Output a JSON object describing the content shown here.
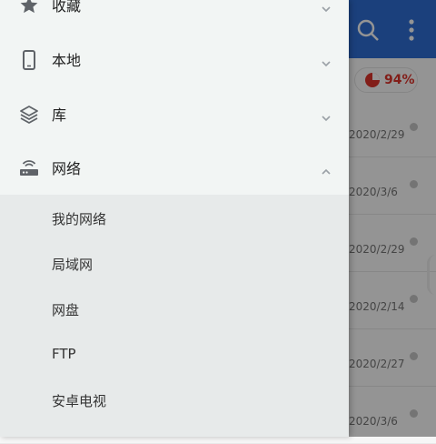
{
  "background": {
    "storage_badge": "94%",
    "dates": [
      "2020/2/29",
      "2020/3/6",
      "2020/2/29",
      "2020/2/14",
      "2020/2/27",
      "2020/3/6"
    ],
    "topbar_icons": [
      "search-icon",
      "more-vert-icon"
    ]
  },
  "drawer": {
    "items": [
      {
        "label": "收藏",
        "icon": "star-icon",
        "expanded": false
      },
      {
        "label": "本地",
        "icon": "phone-icon",
        "expanded": false
      },
      {
        "label": "库",
        "icon": "layers-icon",
        "expanded": false
      },
      {
        "label": "网络",
        "icon": "router-icon",
        "expanded": true
      }
    ],
    "network_sub_items": [
      "我的网络",
      "局域网",
      "网盘",
      "FTP",
      "安卓电视"
    ]
  },
  "colors": {
    "accent": "#2f6fd6",
    "storage_red": "#e0342c",
    "drawer_bg": "#f2f5f4",
    "submenu_bg": "#e7eaea"
  }
}
